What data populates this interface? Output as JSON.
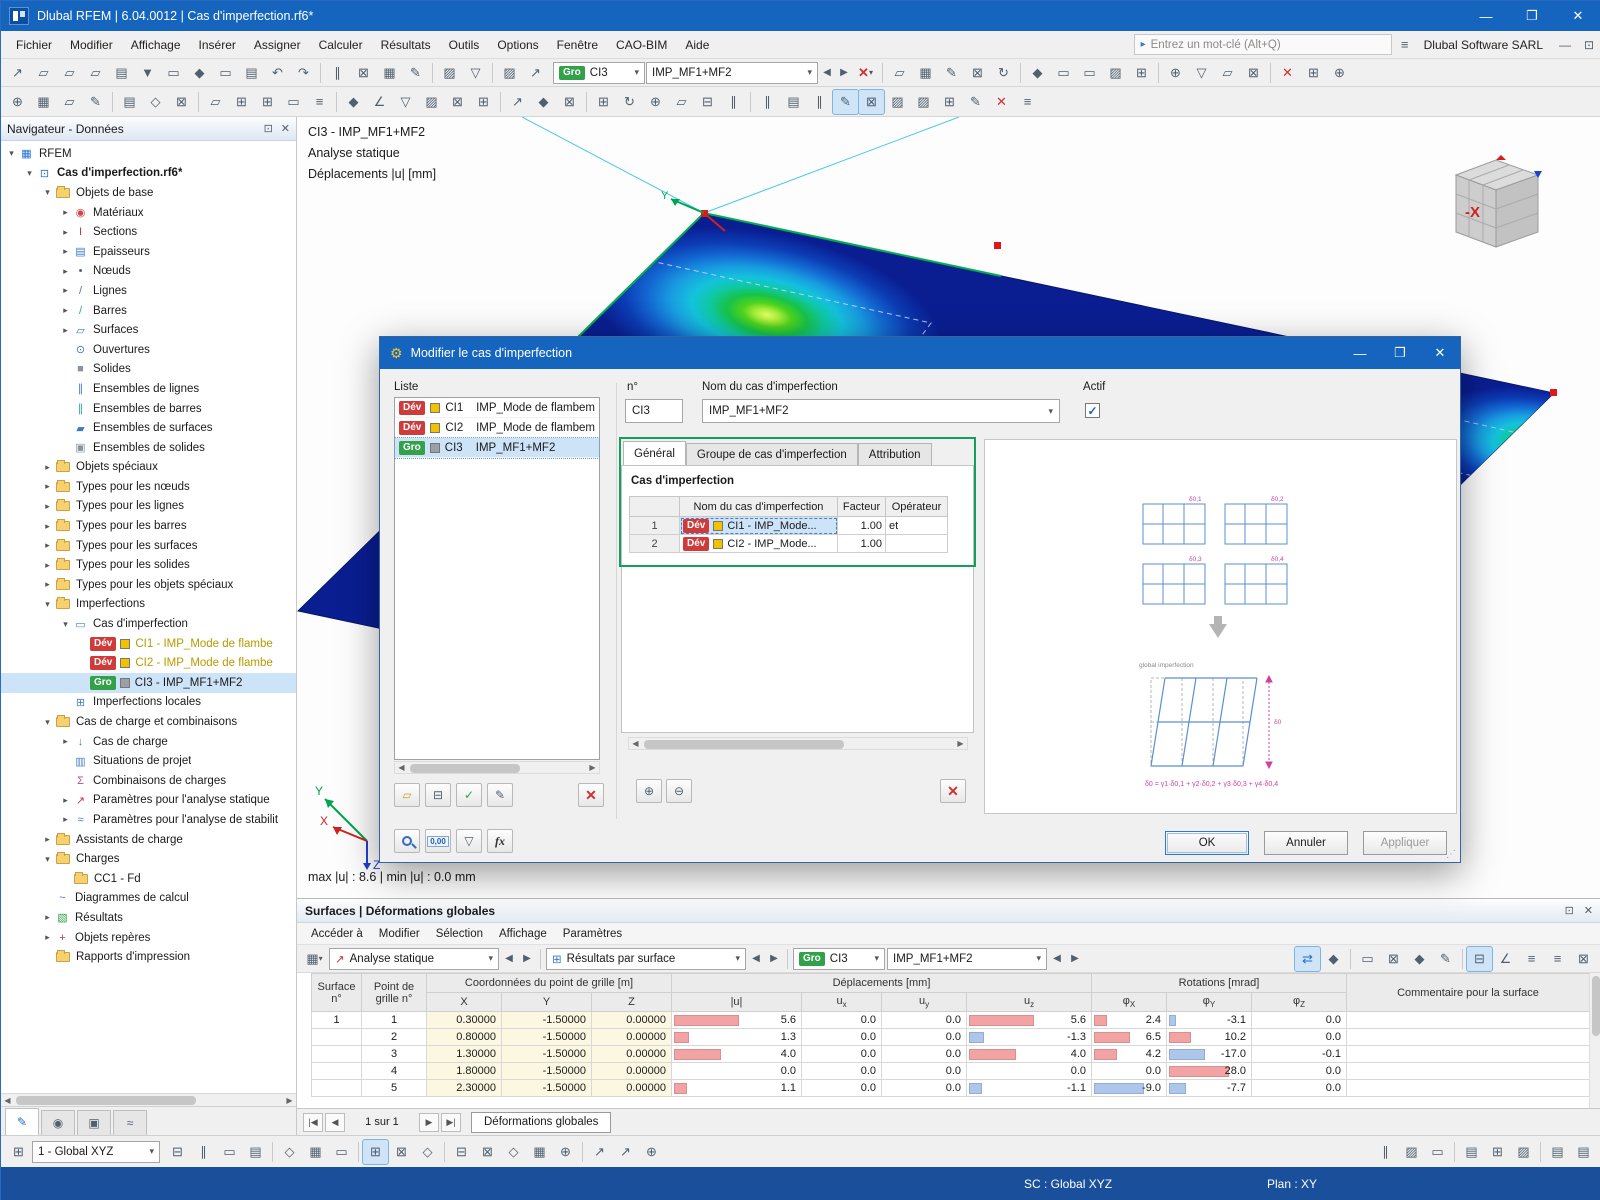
{
  "window": {
    "title": "Dlubal RFEM | 6.04.0012 | Cas d'imperfection.rf6*",
    "vendor": "Dlubal Software SARL",
    "search_placeholder": "Entrez un mot-clé (Alt+Q)"
  },
  "menu": {
    "items": [
      "Fichier",
      "Modifier",
      "Affichage",
      "Insérer",
      "Assigner",
      "Calculer",
      "Résultats",
      "Outils",
      "Options",
      "Fenêtre",
      "CAO-BIM",
      "Aide"
    ]
  },
  "case_selector": {
    "badge": "Gro",
    "case_id": "CI3",
    "case_name": "IMP_MF1+MF2"
  },
  "toolbars": {
    "row1_left": [
      "new-model",
      "open-model",
      "dlubal-center",
      "data-navigator",
      "manage-configurations",
      "save",
      "print",
      "printout-report",
      "copy-content",
      "notes",
      "undo",
      "redo",
      "|",
      "window-model",
      "window-model-tables",
      "window-tables",
      "window-report",
      "|",
      "dimensions",
      "display-properties",
      "|",
      "link-surfaces",
      "link-members"
    ],
    "row1_right": [
      "|",
      "show-results",
      "show-result-values",
      "filter-surfaces",
      "filter-members",
      "result-tables",
      "|",
      "zoom-select",
      "pan-view",
      "rotate-view",
      "full-view",
      "measure",
      "|",
      "clipping-plane",
      "visibility",
      "user-views",
      "display-settings",
      "|",
      "delete-results",
      "regenerate-model",
      "find-object"
    ],
    "row2": [
      "favorites",
      "edit-special",
      "edit-dimensions",
      "edit-node",
      "|",
      "generate-nodes",
      "generate-lines",
      "generate-surfaces",
      "|",
      "swap-orientation",
      "insert-node",
      "shapes",
      "copy-move",
      "rotate-objects",
      "|",
      "connect-lines",
      "divide-lines",
      "merge-lines",
      "intersect-lines",
      "extend-lines",
      "trim-lines",
      "|",
      "split-surface",
      "shrink-objects",
      "measure-angle",
      "|",
      "align-objects",
      "parallel-copy",
      "orthogonal-view",
      "work-plane",
      "slope",
      "check-model",
      "|",
      "grid-settings",
      "mesh-settings",
      "view-x",
      "view-y*",
      "view-z*",
      "view-iso",
      "mark-nodes",
      "percent-scale",
      "swap-axes",
      "delete-objects",
      "box-select"
    ]
  },
  "navigator": {
    "title": "Navigateur - Données",
    "tree": [
      {
        "lvl": 0,
        "label": "RFEM",
        "icon": "rfem",
        "exp": "v"
      },
      {
        "lvl": 1,
        "label": "Cas d'imperfection.rf6*",
        "icon": "project",
        "exp": "v",
        "bold": true
      },
      {
        "lvl": 2,
        "label": "Objets de base",
        "icon": "folder",
        "exp": "v"
      },
      {
        "lvl": 3,
        "label": "Matériaux",
        "icon": "materials",
        "exp": ">"
      },
      {
        "lvl": 3,
        "label": "Sections",
        "icon": "sections",
        "exp": ">"
      },
      {
        "lvl": 3,
        "label": "Épaisseurs",
        "icon": "thicknesses",
        "exp": ">"
      },
      {
        "lvl": 3,
        "label": "Nœuds",
        "icon": "nodes",
        "exp": ">"
      },
      {
        "lvl": 3,
        "label": "Lignes",
        "icon": "lines",
        "exp": ">"
      },
      {
        "lvl": 3,
        "label": "Barres",
        "icon": "members",
        "exp": ">"
      },
      {
        "lvl": 3,
        "label": "Surfaces",
        "icon": "surfaces",
        "exp": ">"
      },
      {
        "lvl": 3,
        "label": "Ouvertures",
        "icon": "openings",
        "exp": ""
      },
      {
        "lvl": 3,
        "label": "Solides",
        "icon": "solids",
        "exp": ""
      },
      {
        "lvl": 3,
        "label": "Ensembles de lignes",
        "icon": "line-sets",
        "exp": ""
      },
      {
        "lvl": 3,
        "label": "Ensembles de barres",
        "icon": "member-sets",
        "exp": ""
      },
      {
        "lvl": 3,
        "label": "Ensembles de surfaces",
        "icon": "surface-sets",
        "exp": ""
      },
      {
        "lvl": 3,
        "label": "Ensembles de solides",
        "icon": "solid-sets",
        "exp": ""
      },
      {
        "lvl": 2,
        "label": "Objets spéciaux",
        "icon": "folder",
        "exp": ">"
      },
      {
        "lvl": 2,
        "label": "Types pour les nœuds",
        "icon": "folder",
        "exp": ">"
      },
      {
        "lvl": 2,
        "label": "Types pour les lignes",
        "icon": "folder",
        "exp": ">"
      },
      {
        "lvl": 2,
        "label": "Types pour les barres",
        "icon": "folder",
        "exp": ">"
      },
      {
        "lvl": 2,
        "label": "Types pour les surfaces",
        "icon": "folder",
        "exp": ">"
      },
      {
        "lvl": 2,
        "label": "Types pour les solides",
        "icon": "folder",
        "exp": ">"
      },
      {
        "lvl": 2,
        "label": "Types pour les objets spéciaux",
        "icon": "folder",
        "exp": ">"
      },
      {
        "lvl": 2,
        "label": "Imperfections",
        "icon": "folder",
        "exp": "v"
      },
      {
        "lvl": 3,
        "label": "Cas d'imperfection",
        "icon": "imperfection-case",
        "exp": "v"
      },
      {
        "lvl": 4,
        "label": "CI1 - IMP_Mode de flambe",
        "badge": "Dév",
        "badge_color": "#cf3b3b",
        "swatch": "#f2c200",
        "color": "#b89a00"
      },
      {
        "lvl": 4,
        "label": "CI2 - IMP_Mode de flambe",
        "badge": "Dév",
        "badge_color": "#cf3b3b",
        "swatch": "#f2c200",
        "color": "#b89a00"
      },
      {
        "lvl": 4,
        "label": "CI3 - IMP_MF1+MF2",
        "badge": "Gro",
        "badge_color": "#33a04a",
        "swatch": "#9aa0a6",
        "sel": true
      },
      {
        "lvl": 3,
        "label": "Imperfections locales",
        "icon": "local-imperfections",
        "exp": ""
      },
      {
        "lvl": 2,
        "label": "Cas de charge et combinaisons",
        "icon": "folder",
        "exp": "v"
      },
      {
        "lvl": 3,
        "label": "Cas de charge",
        "icon": "load-cases",
        "exp": ">"
      },
      {
        "lvl": 3,
        "label": "Situations de projet",
        "icon": "design-situations",
        "exp": ""
      },
      {
        "lvl": 3,
        "label": "Combinaisons de charges",
        "icon": "load-combinations",
        "exp": ""
      },
      {
        "lvl": 3,
        "label": "Paramètres pour l'analyse statique",
        "icon": "static-analysis-settings",
        "exp": ">"
      },
      {
        "lvl": 3,
        "label": "Paramètres pour l'analyse de stabilit",
        "icon": "stability-analysis-settings",
        "exp": ">"
      },
      {
        "lvl": 2,
        "label": "Assistants de charge",
        "ic on": "folder",
        "icon": "folder",
        "exp": ">"
      },
      {
        "lvl": 2,
        "label": "Charges",
        "icon": "folder",
        "exp": "v"
      },
      {
        "lvl": 3,
        "label": "CC1 - Fd",
        "icon": "folder",
        "exp": ""
      },
      {
        "lvl": 2,
        "label": "Diagrammes de calcul",
        "icon": "calculation-diagrams",
        "exp": ""
      },
      {
        "lvl": 2,
        "label": "Résultats",
        "icon": "results",
        "exp": ">"
      },
      {
        "lvl": 2,
        "label": "Objets repères",
        "icon": "guide-objects",
        "exp": ">"
      },
      {
        "lvl": 2,
        "label": "Rapports d'impression",
        "icon": "folder",
        "exp": ""
      }
    ],
    "tabs": [
      "data-navigator-tab*",
      "display-navigator-tab",
      "views-navigator-tab",
      "panel-navigator-tab"
    ]
  },
  "viewport": {
    "case_line": "CI3 - IMP_MF1+MF2",
    "analysis_line": "Analyse statique",
    "result_line": "Déplacements |u| [mm]",
    "minmax": "max |u| : 8.6 | min |u| : 0.0 mm",
    "axis_labels": {
      "x": "X",
      "y": "Y",
      "z": "Z",
      "plate_y": "Y"
    },
    "navcube_face": "-X"
  },
  "dialog": {
    "title": "Modifier le cas d'imperfection",
    "liste_label": "Liste",
    "list": [
      {
        "badge": "Dév",
        "badge_color": "#cf3b3b",
        "swatch": "#f2c200",
        "id": "CI1",
        "name": "IMP_Mode de flambem"
      },
      {
        "badge": "Dév",
        "badge_color": "#cf3b3b",
        "swatch": "#f2c200",
        "id": "CI2",
        "name": "IMP_Mode de flambem"
      },
      {
        "badge": "Gro",
        "badge_color": "#33a04a",
        "swatch": "#9aa0a6",
        "id": "CI3",
        "name": "IMP_MF1+MF2",
        "sel": true
      }
    ],
    "list_toolbar": [
      "new-imperfection-case",
      "copy-imperfection-case",
      "check-assign",
      "check-edit"
    ],
    "no_label": "n°",
    "no_value": "CI3",
    "name_label": "Nom du cas d'imperfection",
    "name_value": "IMP_MF1+MF2",
    "actif_label": "Actif",
    "tabs": [
      "Général",
      "Groupe de cas d'imperfection",
      "Attribution"
    ],
    "section_title": "Cas d'imperfection",
    "table": {
      "headers": [
        "",
        "Nom du cas d'imperfection",
        "Facteur",
        "Opérateur"
      ],
      "rows": [
        {
          "n": "1",
          "badge": "Dév",
          "badge_color": "#cf3b3b",
          "swatch": "#f2c200",
          "name": "CI1 - IMP_Mode...",
          "factor": "1.00",
          "op": "et",
          "sel": true
        },
        {
          "n": "2",
          "badge": "Dév",
          "badge_color": "#cf3b3b",
          "swatch": "#f2c200",
          "name": "CI2 - IMP_Mode...",
          "factor": "1.00",
          "op": ""
        }
      ]
    },
    "preview": {
      "caption": "global imperfection",
      "formula": "δ0 = γ1·δ0,1 + γ2·δ0,2 + γ3·δ0,3 + γ4·δ0,4"
    },
    "bottom_toolbar": [
      "find-number",
      "decimal-places",
      "units-config",
      "formula-editor"
    ],
    "buttons": {
      "ok": "OK",
      "annuler": "Annuler",
      "appliquer": "Appliquer"
    }
  },
  "results_panel": {
    "title": "Surfaces | Déformations globales",
    "menu": [
      "Accéder à",
      "Modifier",
      "Sélection",
      "Affichage",
      "Paramètres"
    ],
    "combo_analysis": "Analyse statique",
    "combo_result": "Résultats par surface",
    "badge": "Gro",
    "case_id": "CI3",
    "case_name": "IMP_MF1+MF2",
    "right_icons": [
      "show-deformation*",
      "pointer-values",
      "|",
      "max-values",
      "result-grid",
      "save-table",
      "table-chart",
      "|",
      "selected-rows*",
      "all-rows",
      "print-table",
      "table-settings",
      "refresh-table"
    ],
    "table": {
      "row_headers": [
        "Surface n°",
        "Point de grille n°"
      ],
      "groups": [
        {
          "label": "Coordonnées du point de grille [m]",
          "span": 3
        },
        {
          "label": "Déplacements [mm]",
          "span": 4
        },
        {
          "label": "Rotations [mrad]",
          "span": 3
        }
      ],
      "comment_header": "Commentaire pour la surface",
      "col_headers": [
        "X",
        "Y",
        "Z",
        "|u|",
        "u_x",
        "u_y",
        "u_z",
        "φ_X",
        "φ_Y",
        "φ_Z"
      ],
      "rows": [
        [
          "1",
          "1",
          "0.30000",
          "-1.50000",
          "0.00000",
          "5.6",
          "0.0",
          "0.0",
          "5.6",
          "2.4",
          "-3.1",
          "0.0",
          ""
        ],
        [
          "",
          "2",
          "0.80000",
          "-1.50000",
          "0.00000",
          "1.3",
          "0.0",
          "0.0",
          "-1.3",
          "6.5",
          "10.2",
          "0.0",
          ""
        ],
        [
          "",
          "3",
          "1.30000",
          "-1.50000",
          "0.00000",
          "4.0",
          "0.0",
          "0.0",
          "4.0",
          "4.2",
          "-17.0",
          "-0.1",
          ""
        ],
        [
          "",
          "4",
          "1.80000",
          "-1.50000",
          "0.00000",
          "0.0",
          "0.0",
          "0.0",
          "0.0",
          "0.0",
          "28.0",
          "0.0",
          ""
        ],
        [
          "",
          "5",
          "2.30000",
          "-1.50000",
          "0.00000",
          "1.1",
          "0.0",
          "0.0",
          "-1.1",
          "-9.0",
          "-7.7",
          "0.0",
          ""
        ]
      ]
    },
    "pagination": "1 sur 1",
    "tab_label": "Déformations globales"
  },
  "bottom_toolbar": {
    "view_combo": "1 - Global XYZ",
    "icons_left": [
      "work-plane-grid",
      "move-grid",
      "snap-objects",
      "snap-grid",
      "|",
      "guideline-new",
      "guideline-lock",
      "guideline-edit",
      "|",
      "plane-xy*",
      "plane-yz",
      "plane-xz",
      "|",
      "snap-node",
      "snap-middle",
      "snap-perpendicular",
      "snap-intersection",
      "snap-orientation",
      "|",
      "ortho-mode",
      "polar-tracking",
      "object-tracking"
    ],
    "icons_right": [
      "render-solid",
      "render-transparent",
      "render-wireframe",
      "|",
      "show-loads",
      "show-supports",
      "show-mesh",
      "|",
      "sound-alerts",
      "warning-list"
    ]
  },
  "statusbar": {
    "sc": "SC : Global XYZ",
    "plan": "Plan : XY"
  },
  "colors": {
    "accent": "#1565bf",
    "dev_badge": "#cf3b3b",
    "gro_badge": "#33a04a",
    "bar_pos": "#f2a3a3",
    "bar_neg": "#adc6ea"
  }
}
